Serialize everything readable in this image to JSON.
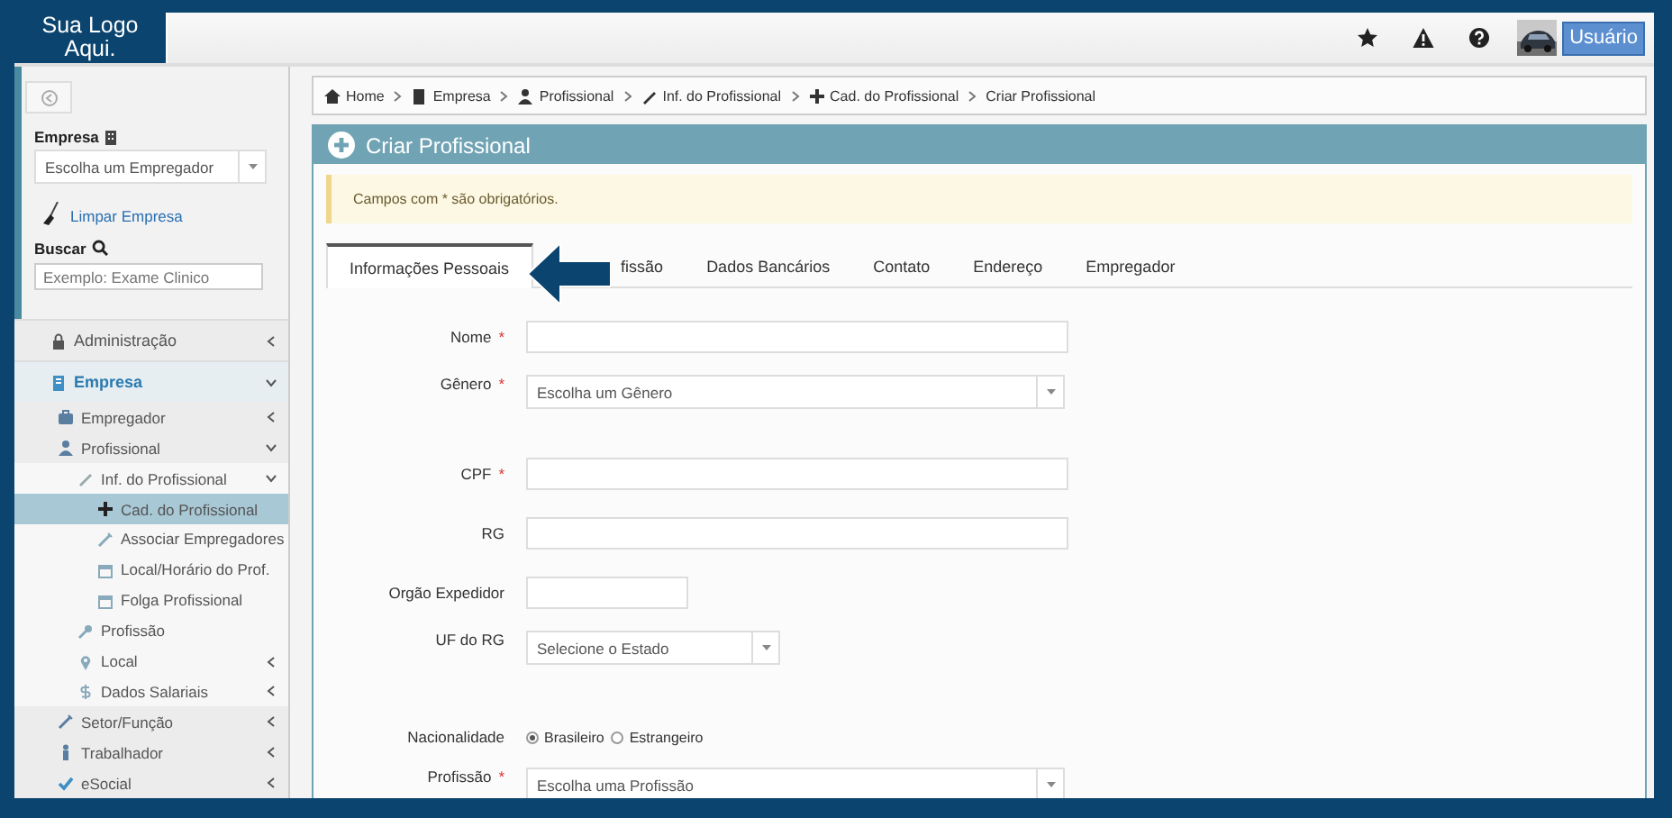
{
  "header": {
    "logo": "Sua Logo Aqui.",
    "user_button": "Usuário"
  },
  "sidebar": {
    "company_label": "Empresa",
    "company_select": {
      "placeholder": "Escolha um Empregador"
    },
    "clear_link": "Limpar Empresa",
    "search_label": "Buscar",
    "search": {
      "placeholder": "Exemplo: Exame Clinico"
    },
    "items": [
      {
        "label": "Administração",
        "expanded": false,
        "selected": false
      },
      {
        "label": "Empresa",
        "expanded": true,
        "selected": false,
        "children": [
          {
            "label": "Empregador",
            "expanded": false,
            "selected": false
          },
          {
            "label": "Profissional",
            "expanded": true,
            "selected": false,
            "children": [
              {
                "label": "Inf. do Profissional",
                "expanded": true,
                "selected": false,
                "children": [
                  {
                    "label": "Cad. do Profissional",
                    "selected": true
                  },
                  {
                    "label": "Associar Empregadores",
                    "selected": false
                  },
                  {
                    "label": "Local/Horário do Prof.",
                    "selected": false
                  },
                  {
                    "label": "Folga Profissional",
                    "selected": false
                  }
                ]
              },
              {
                "label": "Profissão",
                "selected": false
              },
              {
                "label": "Local",
                "expanded": false,
                "selected": false
              },
              {
                "label": "Dados Salariais",
                "expanded": false,
                "selected": false
              }
            ]
          },
          {
            "label": "Setor/Função",
            "expanded": false,
            "selected": false
          },
          {
            "label": "Trabalhador",
            "expanded": false,
            "selected": false
          },
          {
            "label": "eSocial",
            "expanded": false,
            "selected": false
          }
        ]
      }
    ]
  },
  "breadcrumb": [
    "Home",
    "Empresa",
    "Profissional",
    "Inf. do Profissional",
    "Cad. do Profissional",
    "Criar Profissional"
  ],
  "panel_title": "Criar Profissional",
  "alert": "Campos com * são obrigatórios.",
  "tabs": [
    {
      "label": "Informações Pessoais",
      "selected": true
    },
    {
      "label": "fissão",
      "selected": false
    },
    {
      "label": "Dados Bancários",
      "selected": false
    },
    {
      "label": "Contato",
      "selected": false
    },
    {
      "label": "Endereço",
      "selected": false
    },
    {
      "label": "Empregador",
      "selected": false
    }
  ],
  "fields": [
    {
      "label": "Nome",
      "required_mark": "*",
      "kind": "text"
    },
    {
      "label": "Gênero",
      "required_mark": "*",
      "kind": "select",
      "placeholder": "Escolha um Gênero"
    },
    {
      "label": "CPF",
      "required_mark": "*",
      "kind": "text"
    },
    {
      "label": "RG",
      "kind": "text"
    },
    {
      "label": "Orgão Expedidor",
      "kind": "text"
    },
    {
      "label": "UF do RG",
      "kind": "select",
      "placeholder": "Selecione o Estado"
    },
    {
      "label": "Nacionalidade",
      "kind": "radio",
      "options": [
        {
          "label": "Brasileiro",
          "selected": true
        },
        {
          "label": "Estrangeiro",
          "selected": false
        }
      ]
    },
    {
      "label": "Profissão",
      "required_mark": "*",
      "kind": "select",
      "placeholder": "Escolha uma Profissão"
    }
  ]
}
